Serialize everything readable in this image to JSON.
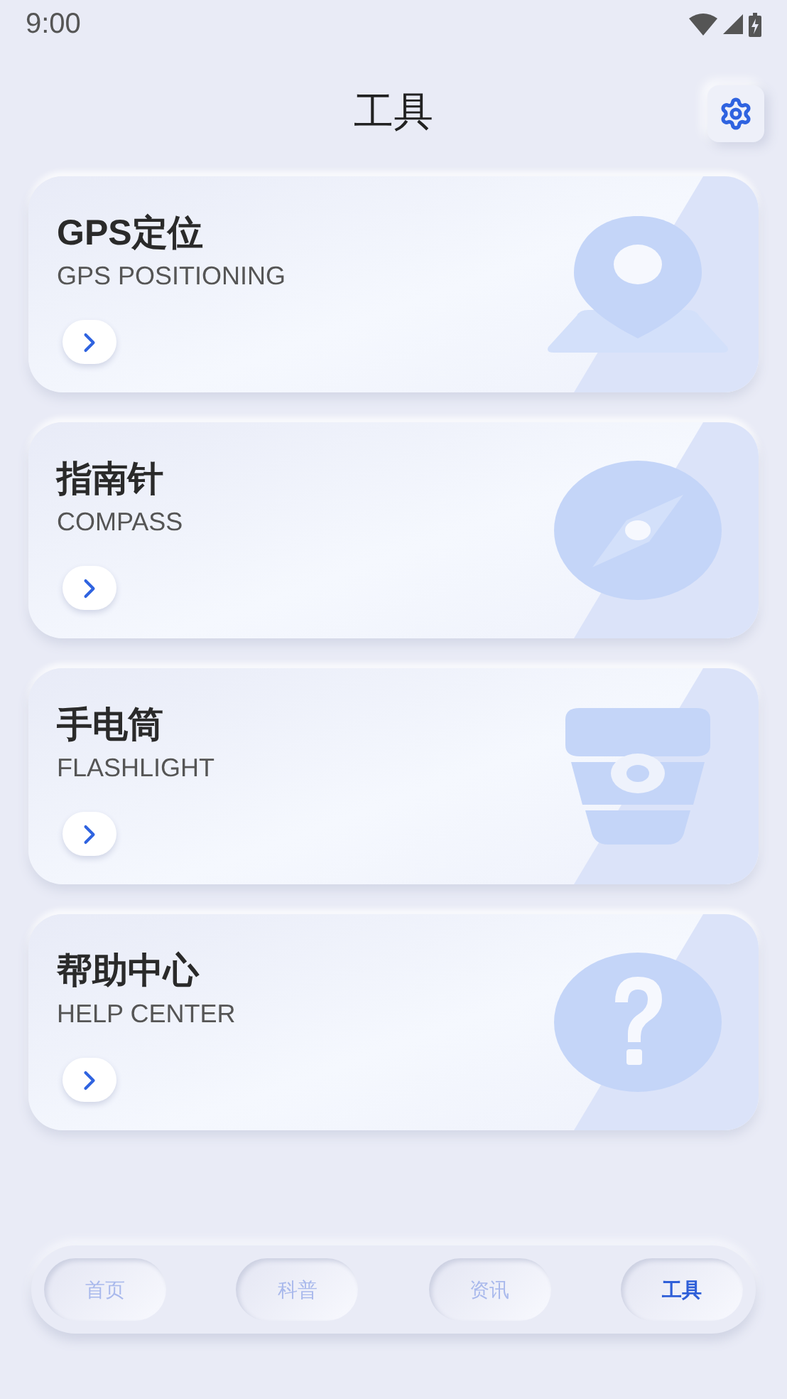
{
  "status_bar": {
    "time": "9:00"
  },
  "header": {
    "title": "工具"
  },
  "cards": [
    {
      "kind": "pin",
      "title": "GPS定位",
      "subtitle": "GPS POSITIONING"
    },
    {
      "kind": "compass",
      "title": "指南针",
      "subtitle": "COMPASS"
    },
    {
      "kind": "flashlight",
      "title": "手电筒",
      "subtitle": "FLASHLIGHT"
    },
    {
      "kind": "help",
      "title": "帮助中心",
      "subtitle": "HELP CENTER"
    }
  ],
  "nav": [
    {
      "label": "首页",
      "selected": false
    },
    {
      "label": "科普",
      "selected": false
    },
    {
      "label": "资讯",
      "selected": false
    },
    {
      "label": "工具",
      "selected": true
    }
  ]
}
